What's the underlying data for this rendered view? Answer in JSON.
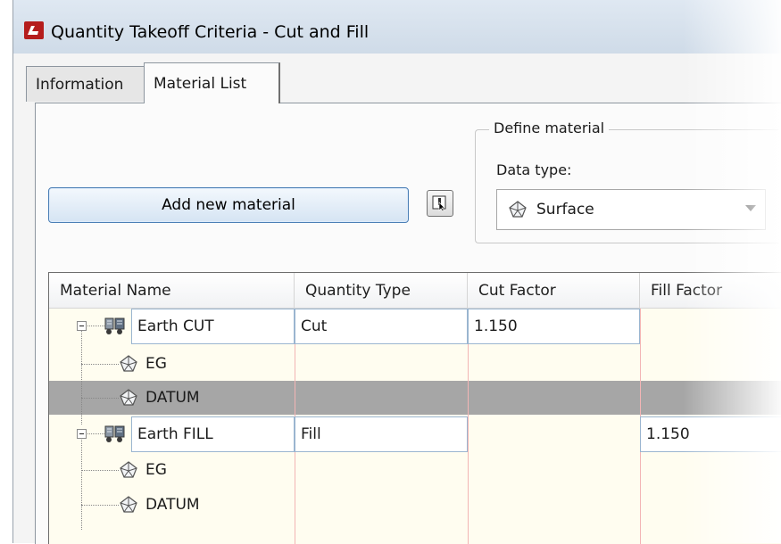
{
  "window": {
    "title": "Quantity Takeoff Criteria - Cut and Fill"
  },
  "tabs": [
    {
      "label": "Information"
    },
    {
      "label": "Material List"
    }
  ],
  "toolbar": {
    "add_material_label": "Add new material"
  },
  "define_material": {
    "group_label": "Define material",
    "data_type_label": "Data type:",
    "data_type_value": "Surface"
  },
  "grid": {
    "columns": [
      "Material Name",
      "Quantity Type",
      "Cut Factor",
      "Fill Factor"
    ],
    "rows": [
      {
        "name": "Earth CUT",
        "quantity_type": "Cut",
        "cut_factor": "1.150",
        "fill_factor": "",
        "icon": "material-icon",
        "children": [
          {
            "name": "EG",
            "icon": "surface-icon"
          },
          {
            "name": "DATUM",
            "icon": "surface-icon",
            "selected": true
          }
        ]
      },
      {
        "name": "Earth FILL",
        "quantity_type": "Fill",
        "cut_factor": "",
        "fill_factor": "1.150",
        "icon": "material-icon",
        "children": [
          {
            "name": "EG",
            "icon": "surface-icon"
          },
          {
            "name": "DATUM",
            "icon": "surface-icon"
          }
        ]
      }
    ]
  }
}
